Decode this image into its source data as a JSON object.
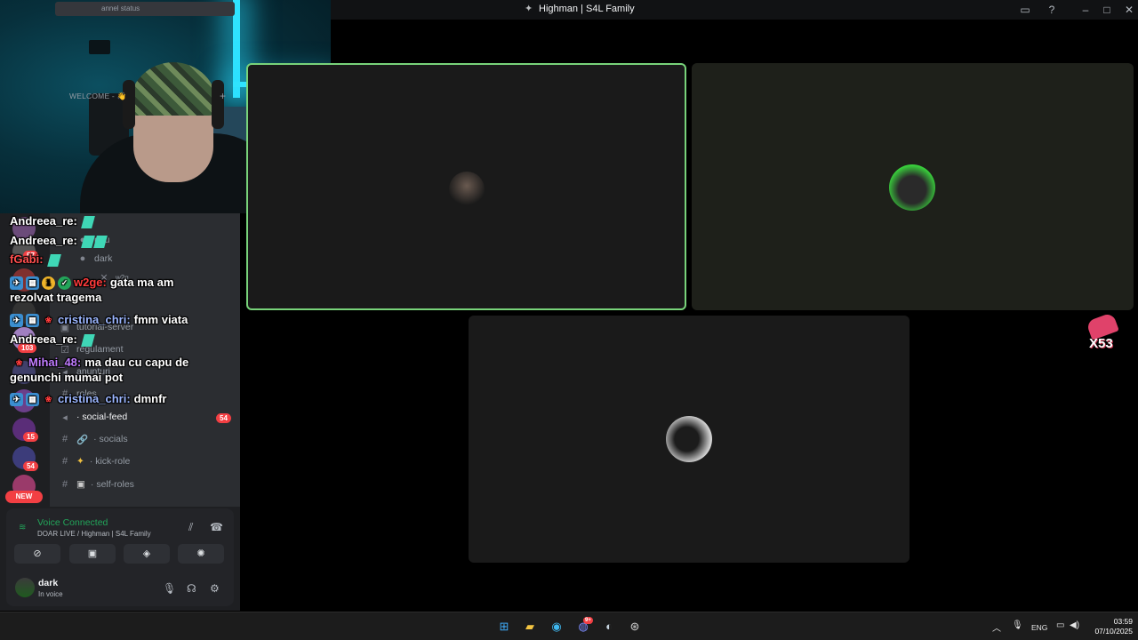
{
  "window": {
    "title": "Highman | S4L Family"
  },
  "channel_status": "annel status",
  "members": [
    {
      "name": "ndu"
    },
    {
      "name": "dark"
    },
    {
      "name": "w2g"
    }
  ],
  "category": "WELCOME - 👋",
  "channels": [
    {
      "label": "tutorial-server"
    },
    {
      "label": "regulament"
    },
    {
      "label": "anunturi"
    },
    {
      "label": "roles"
    },
    {
      "label": "· social-feed",
      "badge": "54"
    },
    {
      "label": "· socials"
    },
    {
      "label": "· kick-role"
    },
    {
      "label": "· self-roles"
    }
  ],
  "server_badges": [
    "57",
    "103",
    "15",
    "54"
  ],
  "new_badge": "NEW",
  "voice": {
    "status": "Voice Connected",
    "sub": "DOAR LIVE / Highman | S4L Family"
  },
  "user": {
    "name": "dark",
    "sub": "In voice"
  },
  "chat": [
    {
      "name": "Andreea_re:",
      "msg": ""
    },
    {
      "name": "Andreea_re:",
      "msg": ""
    },
    {
      "name": "fGabi:",
      "msg": ""
    },
    {
      "name": "w2ge:",
      "msg": "gata ma am",
      "cont": "rezolvat tragema"
    },
    {
      "name": "cristina_chri:",
      "msg": "fmm viata"
    },
    {
      "name": "Andreea_re:",
      "msg": ""
    },
    {
      "name": "Mihai_48:",
      "msg": "ma dau cu capu de",
      "cont": "genunchi mumai pot"
    },
    {
      "name": "cristina_chri:",
      "msg": "dmnfr"
    }
  ],
  "chat_badge_number": "1",
  "overlay_logo": "X53",
  "taskbar": {
    "lang": "ENG",
    "time": "03:59",
    "date": "07/10/2025",
    "discord_badge": "9+"
  },
  "colors": {
    "speaking_border": "#78d37a",
    "voice_green": "#23a55a",
    "badge_red": "#f23f43"
  }
}
